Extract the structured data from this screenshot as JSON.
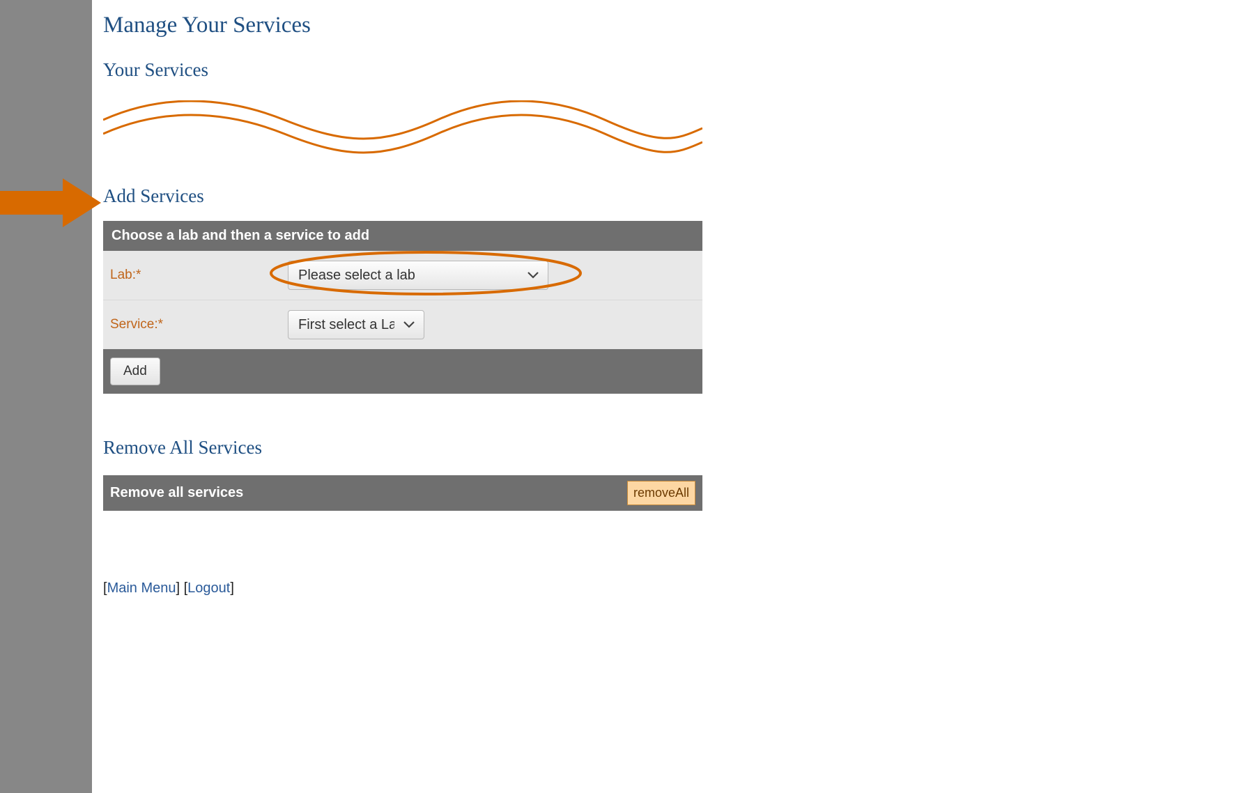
{
  "page": {
    "title": "Manage Your Services"
  },
  "sections": {
    "your_services": {
      "title": "Your Services"
    },
    "add_services": {
      "title": "Add Services",
      "panel_header": "Choose a lab and then a service to add",
      "lab_label": "Lab:*",
      "lab_select_placeholder": "Please select a lab",
      "service_label": "Service:*",
      "service_select_placeholder": "First select a Lab",
      "add_button": "Add"
    },
    "remove_services": {
      "title": "Remove All Services",
      "bar_label": "Remove all services",
      "button_label": "removeAll"
    }
  },
  "footer": {
    "bracket_open": "[",
    "bracket_close": "]",
    "bracket_sep": "] [",
    "main_menu": "Main Menu",
    "logout": "Logout"
  },
  "annotations": {
    "arrow_color": "#d86a00",
    "wave_color": "#d86a00",
    "circle_color": "#d86a00"
  }
}
